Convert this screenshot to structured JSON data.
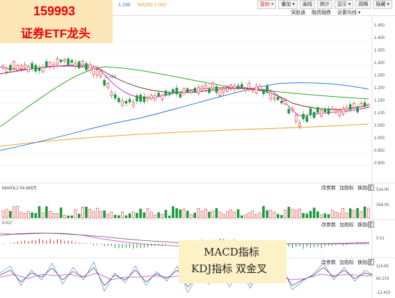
{
  "badge": {
    "code": "159993",
    "name": "证券ETF龙头"
  },
  "note": {
    "line1": "MACD指标",
    "line2": "KDJ指标  双金叉"
  },
  "toolbar": {
    "ma_labels": [
      "1.190",
      "MA250 1.062"
    ],
    "buttons": [
      "复权 ▾",
      "叠加 ▾",
      "画线",
      "统计",
      "显示 ▾",
      "周期",
      "隐藏 ▾"
    ],
    "links": [
      "深股通",
      "融资融券",
      "设置均线 ▾"
    ]
  },
  "price_axis": [
    "1.450",
    "1.400",
    "1.350",
    "1.300",
    "1.250",
    "1.200",
    "1.150",
    "1.100",
    "1.050",
    "1.000",
    "0.950",
    "0.900"
  ],
  "annotation": "1.250",
  "volume_panel": {
    "header": "MAVOL2 54.485万",
    "axis": [
      "514.00",
      "254.00"
    ],
    "buttons": [
      "改参数",
      "加指标",
      "换指标"
    ]
  },
  "macd_panel": {
    "header": "0.017",
    "axis": [
      "0.01"
    ],
    "buttons": [
      "改参数",
      "加指标",
      "换指标"
    ]
  },
  "kdj_panel": {
    "axis": [
      "114.60",
      "60.370",
      "-12.410"
    ],
    "buttons": [
      "改参数",
      "加指标",
      "换指标"
    ]
  },
  "colors": {
    "up": "#e02020",
    "down": "#1a9a3a",
    "ma5": "#cc33cc",
    "ma10": "#7a2b2b",
    "ma20": "#22aa22",
    "ma60": "#2a7ad6",
    "ma250": "#f0a020",
    "badge_text": "#ee0000"
  }
}
